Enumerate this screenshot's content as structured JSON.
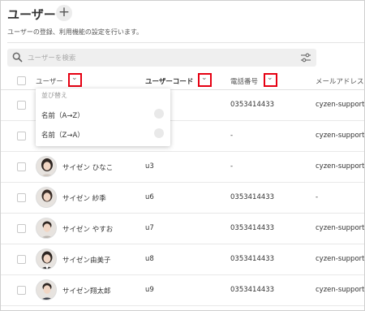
{
  "header": {
    "title": "ユーザー",
    "add_symbol": "+",
    "subtitle": "ユーザーの登録、利用機能の設定を行います。"
  },
  "search": {
    "placeholder": "ユーザーを検索"
  },
  "columns": {
    "user": "ユーザー",
    "user_code": "ユーザーコード",
    "phone": "電話番号",
    "email": "メールアドレス"
  },
  "sort_menu": {
    "title": "並び替え",
    "options": [
      "名前（A→Z）",
      "名前（Z→A）"
    ]
  },
  "rows": [
    {
      "name": "",
      "code": "",
      "phone": "0353414433",
      "email": "cyzen-support@"
    },
    {
      "name": "",
      "code": "",
      "phone": "-",
      "email": "cyzen-support@"
    },
    {
      "name": "サイゼン ひなこ",
      "code": "u3",
      "phone": "-",
      "email": "cyzen-support@"
    },
    {
      "name": "サイゼン 紗季",
      "code": "u6",
      "phone": "0353414433",
      "email": "-"
    },
    {
      "name": "サイゼン やすお",
      "code": "u7",
      "phone": "0353414433",
      "email": "cyzen-support@"
    },
    {
      "name": "サイゼン由美子",
      "code": "u8",
      "phone": "0353414433",
      "email": "cyzen-support@"
    },
    {
      "name": "サイゼン翔太郎",
      "code": "u9",
      "phone": "0353414433",
      "email": "cyzen-support@"
    }
  ],
  "colors": {
    "highlight": "#e60012",
    "hair": "#2e2622",
    "skin": "#f1d6c4"
  }
}
